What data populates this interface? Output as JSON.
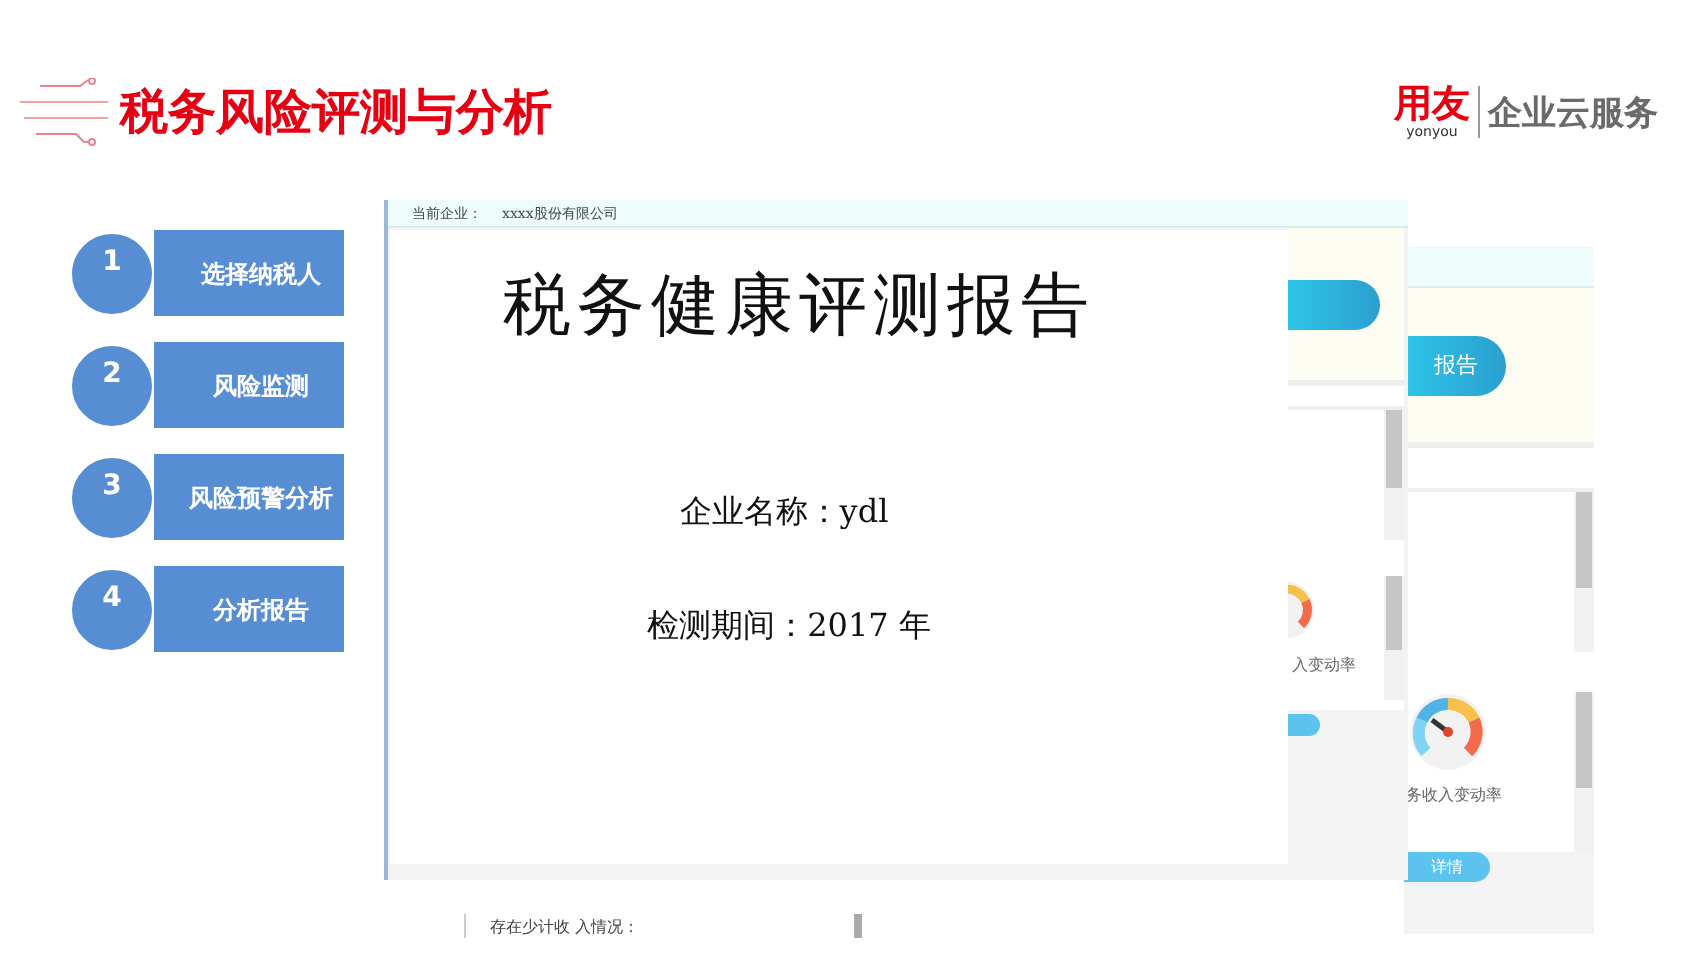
{
  "header": {
    "title": "税务风险评测与分析",
    "brand": {
      "name": "用友",
      "latin": "yonyou",
      "service": "企业云服务"
    }
  },
  "steps": [
    {
      "number": "1",
      "label": "选择纳税人"
    },
    {
      "number": "2",
      "label": "风险监测"
    },
    {
      "number": "3",
      "label": "风险预警分析"
    },
    {
      "number": "4",
      "label": "分析报告"
    }
  ],
  "back_window": {
    "report_button": "报告",
    "gauge_label": "务收入变动率",
    "details_button": "详情"
  },
  "middle_window": {
    "company_label": "当前企业：",
    "company": "xxxx股份有限公司",
    "gauge_label": "入变动率"
  },
  "report": {
    "title": "税务健康评测报告",
    "company_line": "企业名称：ydl",
    "period_line": "检测期间：2017 年"
  },
  "footer_note": "存在少计收 入情况："
}
